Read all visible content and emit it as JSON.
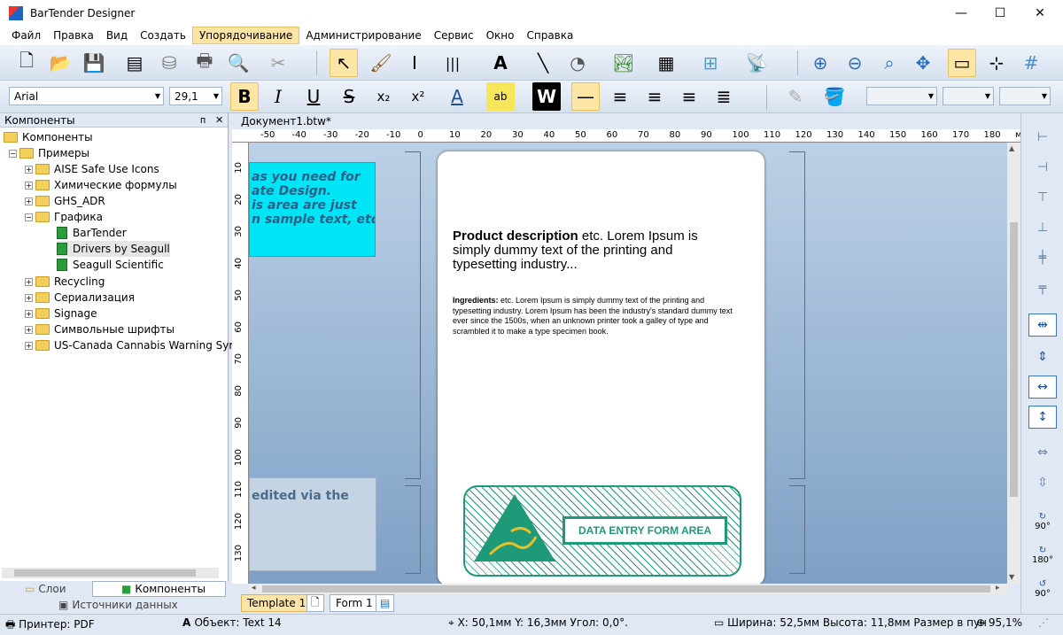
{
  "window": {
    "title": "BarTender Designer",
    "minimize": "—",
    "maximize": "☐",
    "close": "✕"
  },
  "menu": [
    "Файл",
    "Правка",
    "Вид",
    "Создать",
    "Упорядочивание",
    "Администрирование",
    "Сервис",
    "Окно",
    "Справка"
  ],
  "font": {
    "name": "Arial",
    "size": "29,1"
  },
  "panel": {
    "title": "Компоненты",
    "pin": "ᴨ",
    "close": "✕"
  },
  "tree": {
    "root": "Компоненты",
    "examples": "Примеры",
    "items": [
      "AISE Safe Use Icons",
      "Химические формулы",
      "GHS_ADR",
      "Графика"
    ],
    "graphics_children": [
      "BarTender",
      "Drivers by Seagull",
      "Seagull Scientific"
    ],
    "items2": [
      "Recycling",
      "Сериализация",
      "Signage",
      "Символьные шрифты",
      "US-Canada Cannabis Warning Syml"
    ]
  },
  "panel_tabs": {
    "layers": "Слои",
    "components": "Компоненты",
    "data_sources": "Источники данных"
  },
  "document": {
    "tab": "Документ1.btw*"
  },
  "ruler_h": [
    "-50",
    "-40",
    "-30",
    "-20",
    "-10",
    "0",
    "10",
    "20",
    "30",
    "40",
    "50",
    "60",
    "70",
    "80",
    "90",
    "100",
    "110",
    "120",
    "130",
    "140",
    "150",
    "160",
    "170",
    "180",
    "мм"
  ],
  "ruler_v": [
    "10",
    "20",
    "30",
    "40",
    "50",
    "60",
    "70",
    "80",
    "90",
    "100",
    "110",
    "120",
    "130"
  ],
  "canvas": {
    "cyan_text": "as you need for\nate Design.\nis area are just\nn sample text, etc.",
    "gray_text": "edited via the",
    "product_bold": "Product description",
    "product_rest": " etc. Lorem Ipsum is simply dummy text of the printing and typesetting industry...",
    "ingredients_bold": "Ingredients:",
    "ingredients_rest": " etc. Lorem Ipsum is simply dummy text of the printing and typesetting industry. Lorem Ipsum has been the industry's standard dummy text ever since the 1500s, when an unknown printer took a galley of type and scrambled it to make a type specimen book.",
    "data_entry": "DATA ENTRY FORM AREA"
  },
  "bottom_tabs": {
    "template": "Template 1",
    "form": "Form 1"
  },
  "rotate": {
    "r90": "90°",
    "r180": "180°",
    "r90b": "90°"
  },
  "status": {
    "printer": "Принтер: PDF",
    "object": "Объект: Text 14",
    "coords": "X: 50,1мм  Y: 16,3мм  Угол: 0,0°.",
    "size": "Ширина: 52,5мм  Высота: 11,8мм  Размер в пун",
    "zoom": "95,1%"
  },
  "colors": {
    "accent": "#fce3a6",
    "cyan_box": "#00e5f5",
    "green": "#1f9a78"
  }
}
